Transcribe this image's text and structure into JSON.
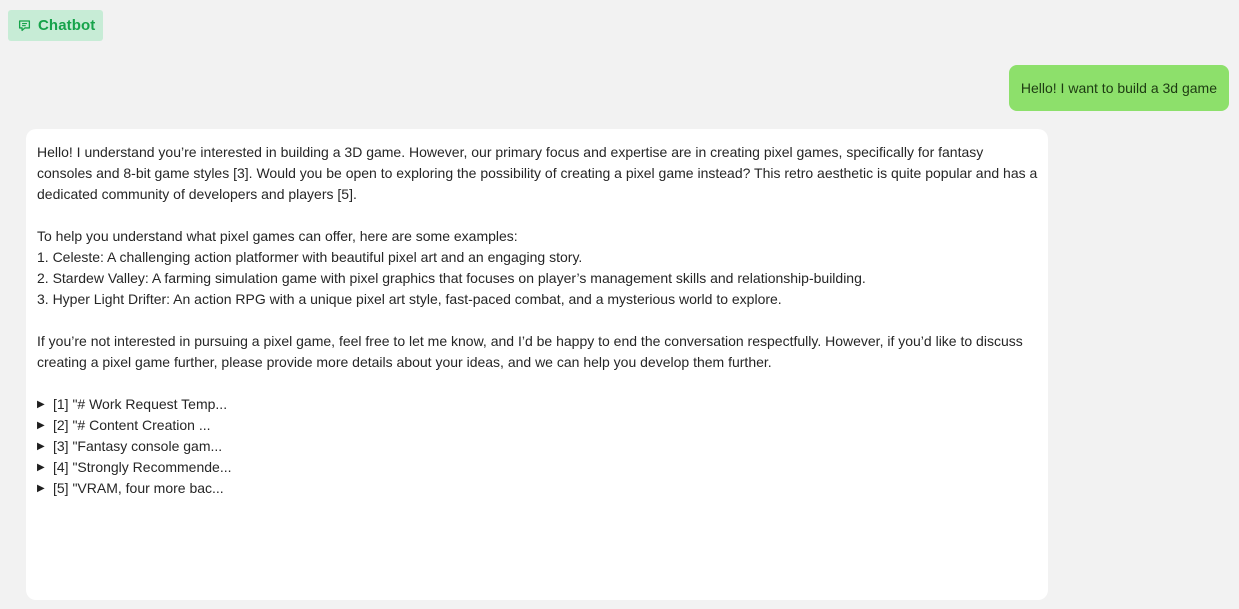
{
  "header": {
    "chip_label": "Chatbot",
    "chip_icon": "chat-icon",
    "accent": "#16a34a",
    "chip_bg": "#c7ecd6"
  },
  "messages": {
    "user": {
      "text": "Hello! I want to build a 3d game",
      "bg": "#8de06b"
    },
    "bot": {
      "para1": "Hello! I understand you’re interested in building a 3D game. However, our primary focus and expertise are in creating pixel games, specifically for fantasy consoles and 8-bit game styles [3]. Would you be open to exploring the possibility of creating a pixel game instead? This retro aesthetic is quite popular and has a dedicated community of developers and players [5].",
      "intro": "To help you understand what pixel games can offer, here are some examples:",
      "examples": [
        "1. Celeste: A challenging action platformer with beautiful pixel art and an engaging story.",
        "2. Stardew Valley: A farming simulation game with pixel graphics that focuses on player’s management skills and relationship-building.",
        "3. Hyper Light Drifter: An action RPG with a unique pixel art style, fast-paced combat, and a mysterious world to explore."
      ],
      "para3": "If you’re not interested in pursuing a pixel game, feel free to let me know, and I’d be happy to end the conversation respectfully. However, if you’d like to discuss creating a pixel game further, please provide more details about your ideas, and we can help you develop them further.",
      "references": [
        "[1] \"# Work Request Temp...",
        "[2] \"# Content Creation ...",
        "[3] \"Fantasy console gam...",
        "[4] \"Strongly Recommende...",
        "[5] \"VRAM, four more bac..."
      ],
      "reference_arrow": "▶"
    }
  }
}
